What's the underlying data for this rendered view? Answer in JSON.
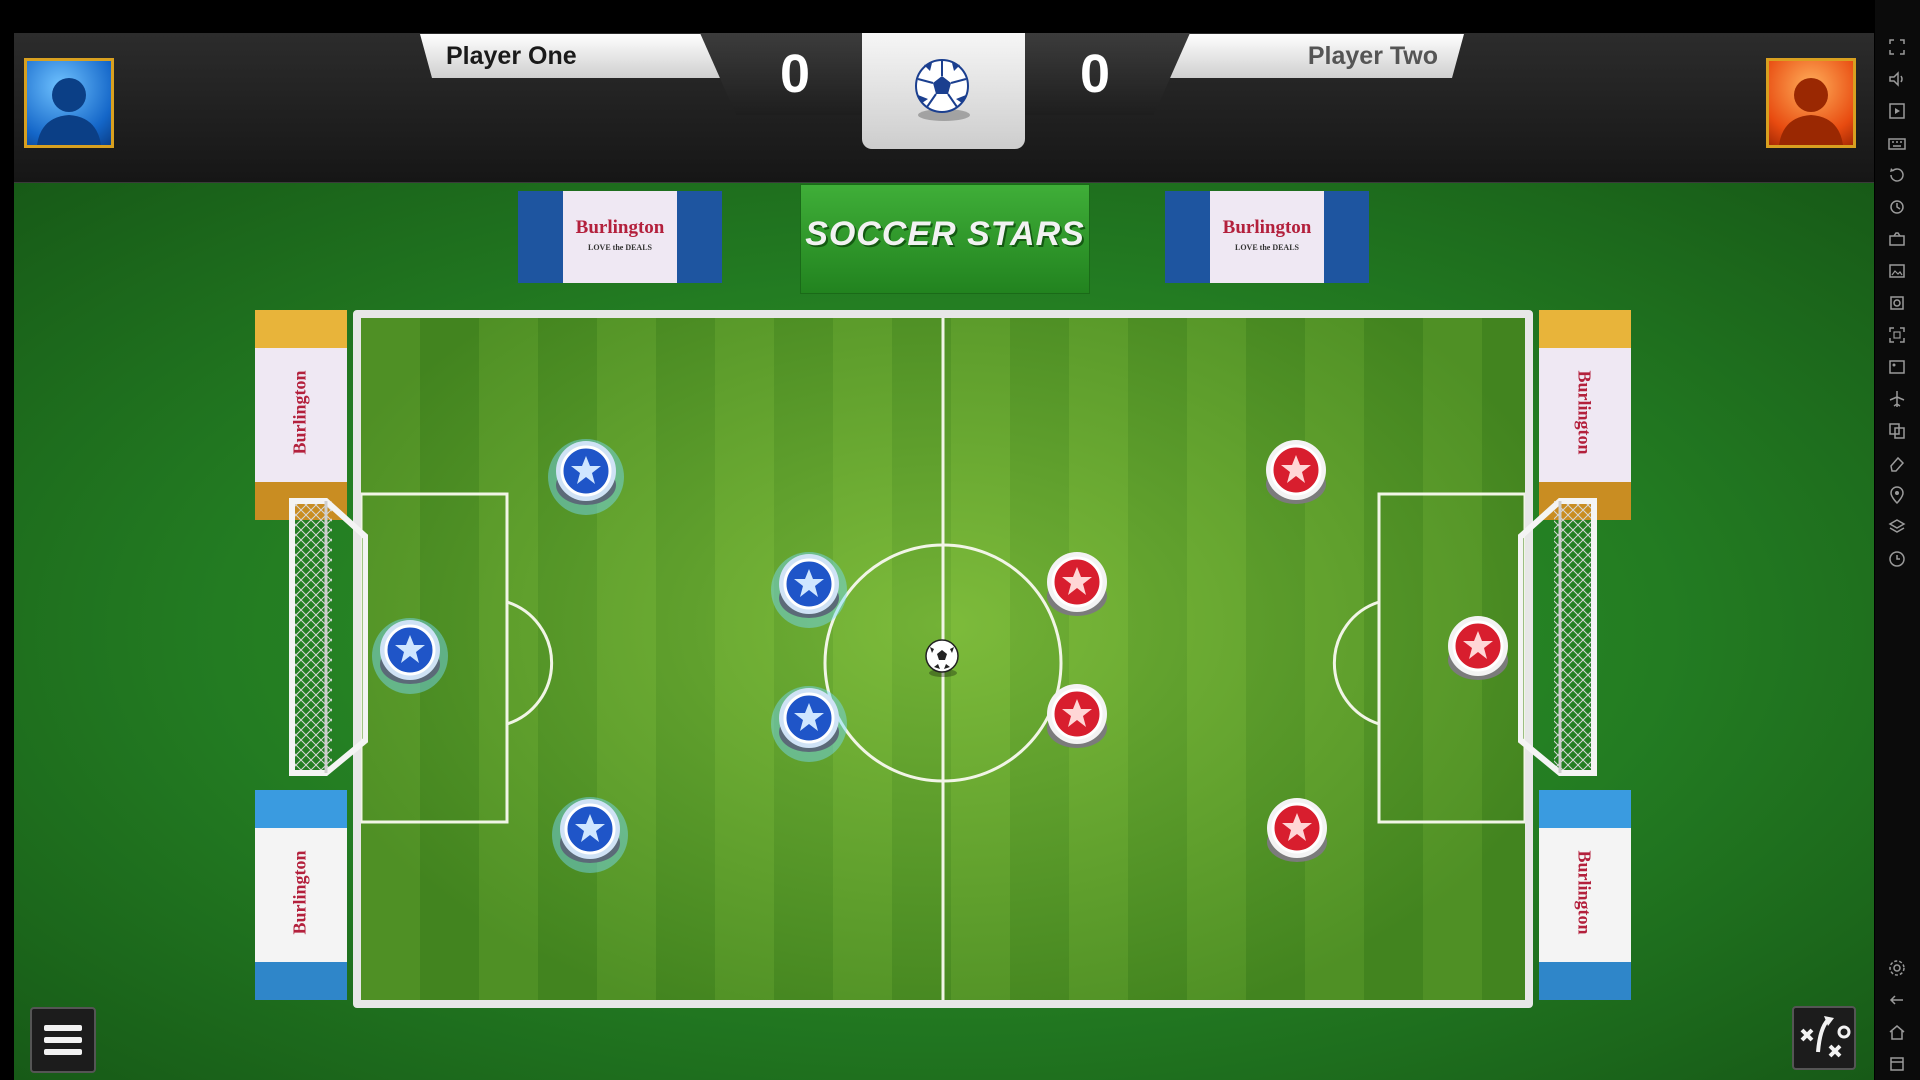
{
  "scoreboard": {
    "player_one_name": "Player One",
    "player_two_name": "Player Two",
    "player_one_score": "0",
    "player_two_score": "0"
  },
  "banners": {
    "game_logo": "SOCCER STARS",
    "sponsor_name": "Burlington",
    "sponsor_tagline": "LOVE the DEALS"
  },
  "teams": {
    "blue_color": "#1f55c8",
    "red_color": "#d81e2e",
    "blue_pucks": 5,
    "red_pucks": 5
  },
  "controls": {
    "menu_icon": "hamburger-menu-icon",
    "tactics_icon": "tactics-formation-icon"
  },
  "sidebar": {
    "icons": [
      "fullscreen-icon",
      "volume-icon",
      "play-icon",
      "keyboard-icon",
      "rotate-icon",
      "refresh-icon",
      "camera-record-icon",
      "gallery-icon",
      "screenshot-icon",
      "fit-screen-icon",
      "image-icon",
      "airplane-icon",
      "copy-icon",
      "eraser-icon",
      "location-icon",
      "layers-icon",
      "history-icon",
      "settings-icon",
      "back-icon",
      "home-icon",
      "recent-apps-icon"
    ]
  }
}
